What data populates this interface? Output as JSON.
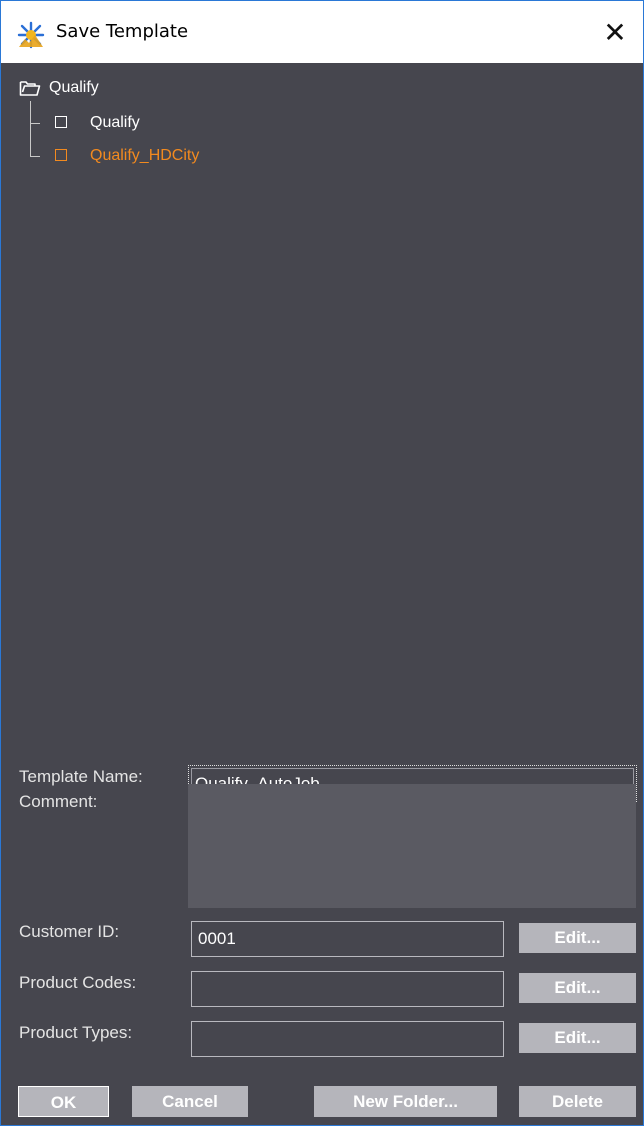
{
  "window": {
    "title": "Save Template",
    "close_glyph": "✕"
  },
  "tree": {
    "root": {
      "label": "Qualify",
      "icon": "folder-open-icon"
    },
    "children": [
      {
        "label": "Qualify",
        "selected": false
      },
      {
        "label": "Qualify_HDCity",
        "selected": true
      }
    ]
  },
  "form": {
    "template_name_label": "Template Name:",
    "template_name_value": "Qualify_AutoJob",
    "comment_label": "Comment:",
    "comment_value": "",
    "customer_id_label": "Customer ID:",
    "customer_id_value": "0001",
    "product_codes_label": "Product Codes:",
    "product_codes_value": "",
    "product_types_label": "Product Types:",
    "product_types_value": "",
    "edit_label": "Edit..."
  },
  "buttons": {
    "ok": "OK",
    "cancel": "Cancel",
    "new_folder": "New Folder...",
    "delete": "Delete"
  },
  "colors": {
    "background": "#46464e",
    "selected_text": "#f28a1f",
    "button": "#b5b5bb"
  }
}
